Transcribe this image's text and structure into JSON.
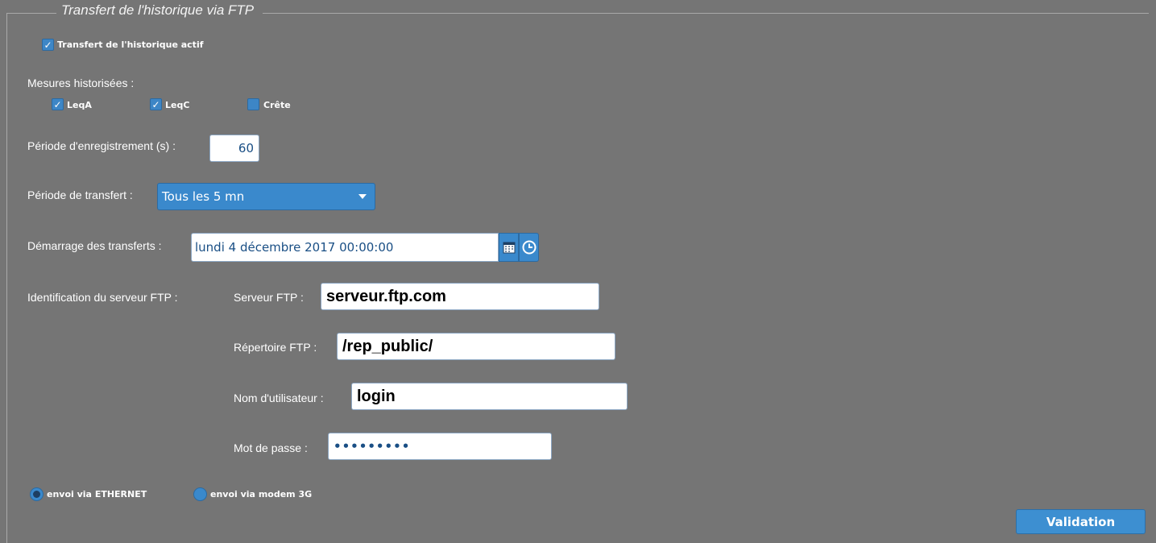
{
  "fieldset": {
    "legend": "Transfert de l'historique via FTP"
  },
  "history_active": {
    "label": "Transfert de l'historique actif",
    "checked": true
  },
  "measures": {
    "title": "Mesures historisées :",
    "items": [
      {
        "label": "LeqA",
        "checked": true
      },
      {
        "label": "LeqC",
        "checked": true
      },
      {
        "label": "Crête",
        "checked": false
      }
    ]
  },
  "record_period": {
    "label": "Période d'enregistrement (s) :",
    "value": "60"
  },
  "transfer_period": {
    "label": "Période de transfert :",
    "selected": "Tous les 5 mn"
  },
  "transfer_start": {
    "label": "Démarrage des transferts :",
    "value": "lundi 4 décembre 2017 00:00:00"
  },
  "ftp": {
    "section_label": "Identification du serveur FTP :",
    "server_label": "Serveur FTP :",
    "server_value": "serveur.ftp.com",
    "dir_label": "Répertoire FTP :",
    "dir_value": "/rep_public/",
    "user_label": "Nom d'utilisateur :",
    "user_value": "login",
    "pass_label": "Mot de passe :",
    "pass_value": "•••••••••"
  },
  "send_mode": {
    "options": [
      {
        "label": "envoi via ETHERNET",
        "selected": true
      },
      {
        "label": "envoi via modem 3G",
        "selected": false
      }
    ]
  },
  "actions": {
    "validate_label": "Validation"
  },
  "colors": {
    "background": "#757575",
    "accent": "#3a89cc",
    "frame": "#a9a9a9"
  }
}
